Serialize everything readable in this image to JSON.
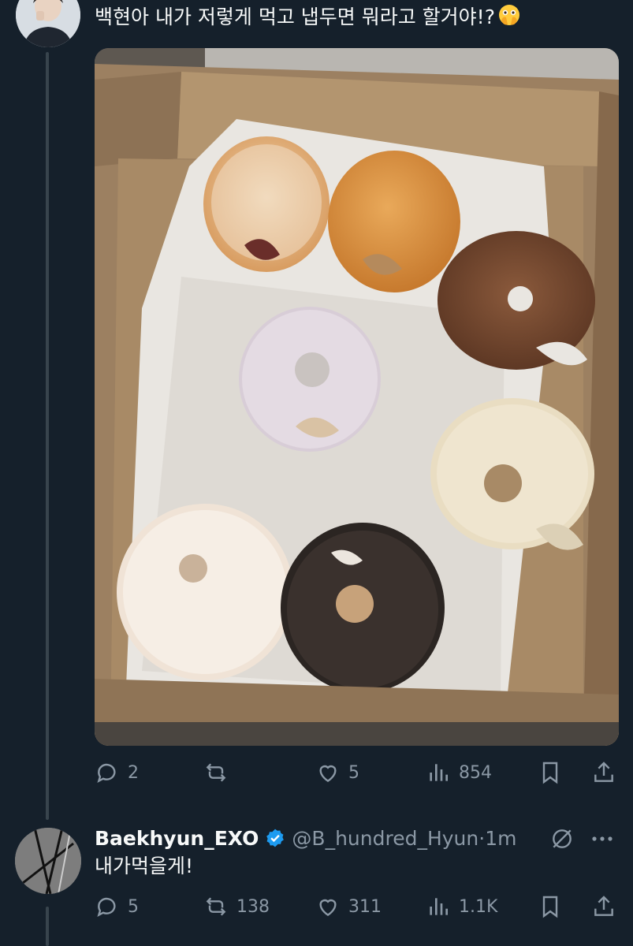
{
  "tweet": {
    "text": "백현아 내가 저렇게 먹고 냅두면 뭐라고 할거야!?",
    "emoji": "face-with-open-eyes-and-hand-over-mouth",
    "photo_description": "box of half-eaten donuts",
    "stats": {
      "replies": "2",
      "retweets": "",
      "likes": "5",
      "views": "854"
    }
  },
  "reply": {
    "display_name": "Baekhyun_EXO",
    "handle": "@B_hundred_Hyun",
    "separator": "·",
    "time": "1m",
    "text": "내가먹을게!",
    "stats": {
      "replies": "5",
      "retweets": "138",
      "likes": "311",
      "views": "1.1K"
    }
  },
  "colors": {
    "background": "#15202b",
    "text": "#f7f9f9",
    "secondary": "#8b98a5",
    "verified": "#1d9bf0",
    "thread_line": "#38444d"
  }
}
